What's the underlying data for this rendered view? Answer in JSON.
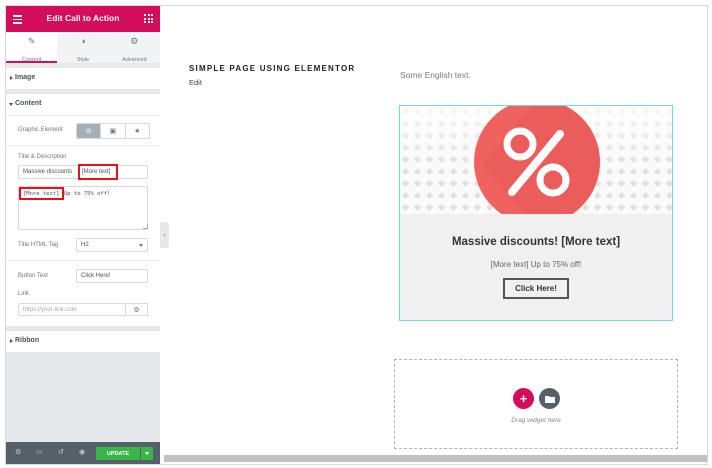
{
  "panel": {
    "header_title": "Edit Call to Action",
    "tabs": [
      {
        "label": "Content",
        "icon": "pencil-icon"
      },
      {
        "label": "Style",
        "icon": "half-circle-icon"
      },
      {
        "label": "Advanced",
        "icon": "gear-icon"
      }
    ],
    "sections": {
      "image": "Image",
      "content": "Content",
      "ribbon": "Ribbon"
    },
    "graphic_element": {
      "label": "Graphic Element",
      "options": [
        "none-icon",
        "image-icon",
        "star-icon"
      ],
      "selected": "none-icon"
    },
    "title_desc": {
      "label": "Title & Description",
      "title_value": "Massive discounts",
      "title_tag": "[More text]",
      "desc_tag": "[More text]",
      "desc_value": " Up to 75% off!"
    },
    "title_html_tag": {
      "label": "Title HTML Tag",
      "value": "H2"
    },
    "button_text": {
      "label": "Button Text",
      "value": "Click Here!"
    },
    "link": {
      "label": "Link",
      "placeholder": "https://your-link.com"
    },
    "footer": {
      "update_label": "UPDATE"
    }
  },
  "canvas": {
    "page_title": "SIMPLE PAGE USING ELEMENTOR",
    "edit_link": "Edit",
    "english_text": "Some English text.",
    "cta": {
      "title": "Massive discounts! [More text]",
      "description": "[More text] Up to 75% off!",
      "button": "Click Here!"
    },
    "dropzone_text": "Drag widget here"
  },
  "colors": {
    "brand": "#d30c5c",
    "update_green": "#39b54a",
    "highlight_red": "#e0141c",
    "selection_blue": "#71d7f7",
    "badge_red": "#f0625f"
  }
}
